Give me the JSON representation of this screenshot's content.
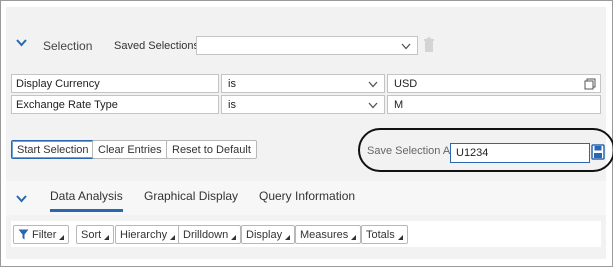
{
  "selection": {
    "title": "Selection",
    "saved_selections_label": "Saved Selections:",
    "saved_selections_value": ""
  },
  "rows": [
    {
      "label": "Display Currency",
      "operator": "is",
      "value": "USD"
    },
    {
      "label": "Exchange Rate Type",
      "operator": "is",
      "value": "M"
    }
  ],
  "buttons": {
    "start": "Start Selection",
    "clear": "Clear Entries",
    "reset": "Reset to Default"
  },
  "save_as": {
    "label": "Save Selection As:",
    "value": "U1234"
  },
  "tabs": [
    {
      "label": "Data Analysis",
      "active": true
    },
    {
      "label": "Graphical Display",
      "active": false
    },
    {
      "label": "Query Information",
      "active": false
    }
  ],
  "toolbar": [
    "Filter",
    "Sort",
    "Hierarchy",
    "Drilldown",
    "Display",
    "Measures",
    "Totals"
  ],
  "colors": {
    "accent": "#2a67b0",
    "panel": "#f2f2f2",
    "filter_icon": "#2a67b0"
  },
  "icons": {
    "collapse": "chevron-down-icon",
    "trash": "trash-icon",
    "value_help": "value-help-icon",
    "save": "save-icon",
    "filter": "filter-icon"
  }
}
